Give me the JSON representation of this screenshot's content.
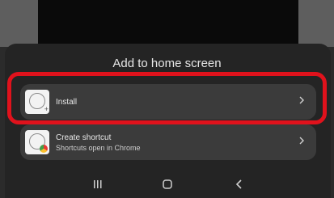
{
  "sheet": {
    "title": "Add to home screen"
  },
  "options": [
    {
      "label": "Install",
      "subtitle": ""
    },
    {
      "label": "Create shortcut",
      "subtitle": "Shortcuts open in Chrome"
    }
  ],
  "colors": {
    "highlight": "#e0121c",
    "sheet_bg": "#242424",
    "item_bg": "#3b3b3b"
  },
  "icons": {
    "install_app": "app-icon-install",
    "shortcut_app": "app-icon-shortcut",
    "chevron": "chevron-right-icon",
    "nav_recents": "recents-icon",
    "nav_home": "home-icon",
    "nav_back": "back-icon"
  }
}
